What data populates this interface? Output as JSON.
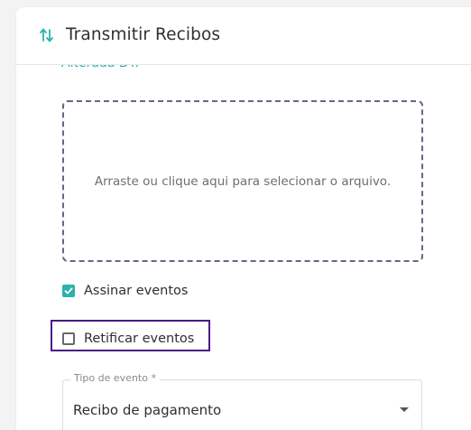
{
  "dialog": {
    "title": "Transmitir Recibos",
    "icon": "swap-vertical-icon",
    "accent_color": "#2bb3ac"
  },
  "partial_link": {
    "text": "Alterada DT."
  },
  "dropzone": {
    "text": "Arraste ou clique aqui para selecionar o arquivo."
  },
  "options": {
    "sign_events": {
      "label": "Assinar eventos",
      "checked": true
    },
    "rectify_events": {
      "label": "Retificar eventos",
      "checked": false,
      "focus_color": "#4a1a86"
    }
  },
  "event_type": {
    "label": "Tipo de evento *",
    "value": "Recibo de pagamento"
  }
}
